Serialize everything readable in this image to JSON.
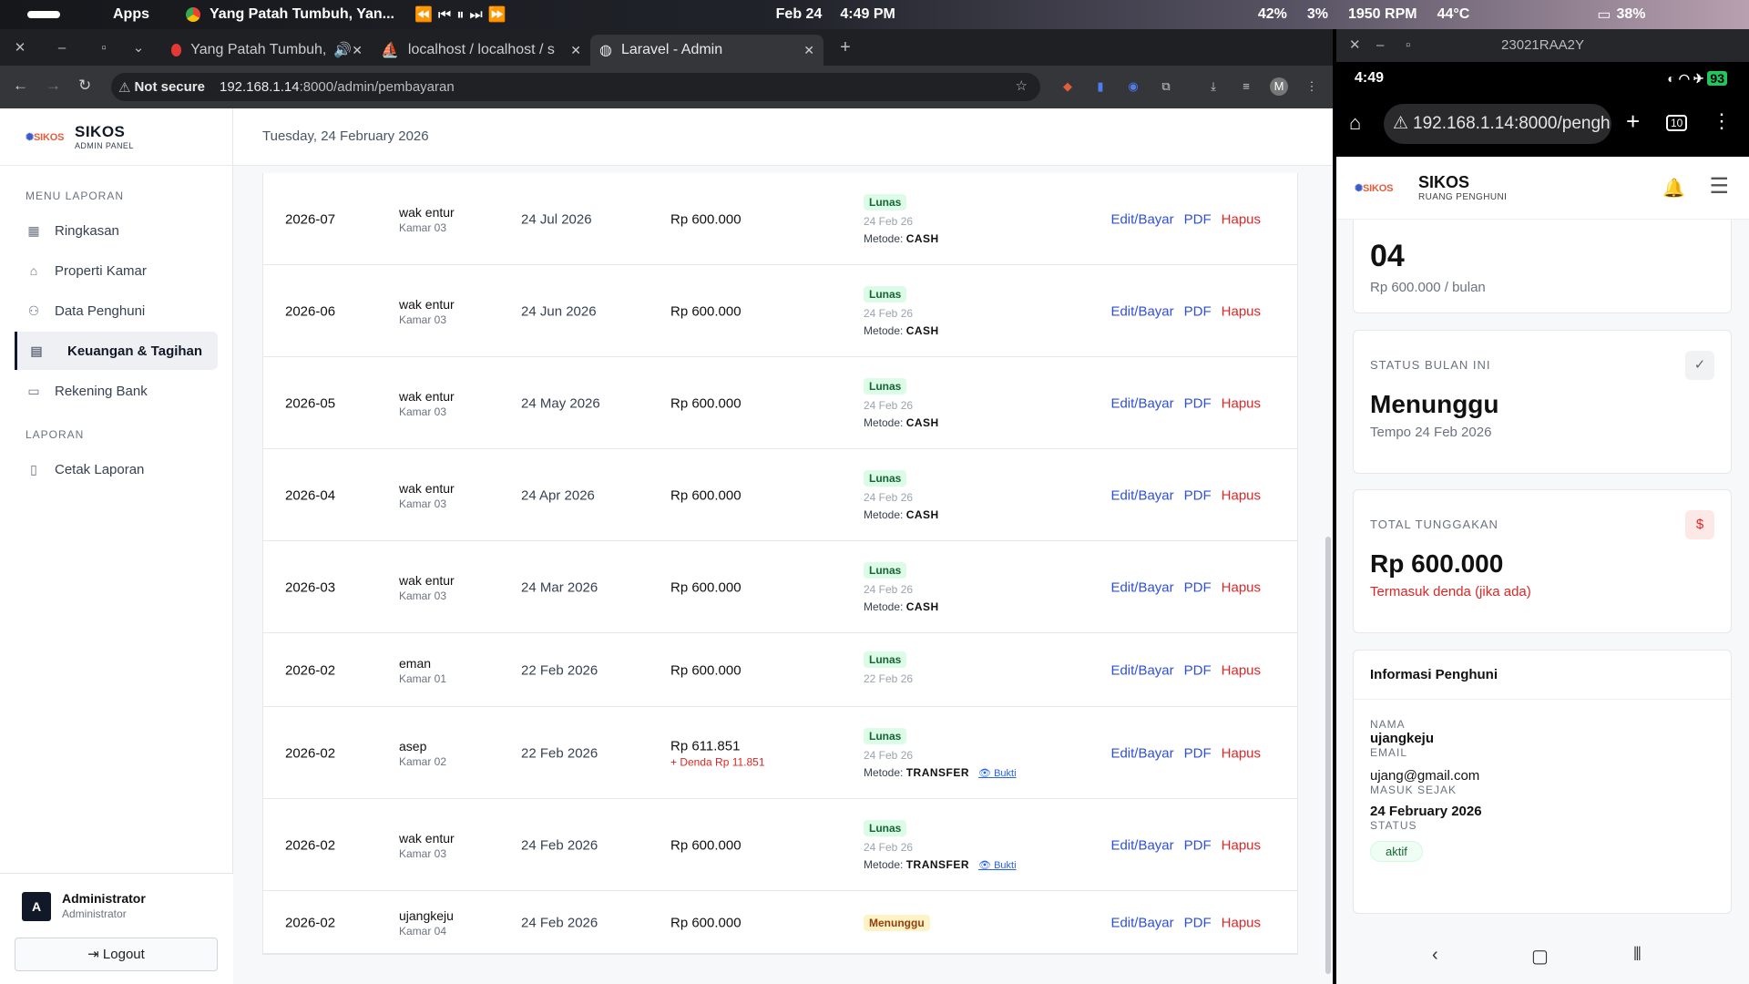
{
  "system_bar": {
    "apps": "Apps",
    "media_title": "Yang Patah Tumbuh, Yan...",
    "date": "Feb 24",
    "time": "4:49 PM",
    "cpu": "42%",
    "mem": "3%",
    "fan": "1950 RPM",
    "temp": "44°C",
    "battery": "38%"
  },
  "browser": {
    "tabs": [
      {
        "label": "Yang Patah Tumbuh,"
      },
      {
        "label": "localhost / localhost / s"
      },
      {
        "label": "Laravel - Admin"
      }
    ],
    "security": "Not secure",
    "url_host": "192.168.1.14",
    "url_path": ":8000/admin/pembayaran",
    "profile": "M"
  },
  "sidebar": {
    "brand": "SIKOS",
    "subtitle": "ADMIN PANEL",
    "logo_text": "SIKOS",
    "section_menu": "MENU LAPORAN",
    "items": [
      {
        "label": "Ringkasan",
        "icon": "grid-icon"
      },
      {
        "label": "Properti Kamar",
        "icon": "home-icon"
      },
      {
        "label": "Data Penghuni",
        "icon": "users-icon"
      },
      {
        "label": "Keuangan & Tagihan",
        "icon": "clipboard-icon"
      },
      {
        "label": "Rekening Bank",
        "icon": "card-icon"
      }
    ],
    "section_report": "LAPORAN",
    "report_items": [
      {
        "label": "Cetak Laporan",
        "icon": "document-icon"
      }
    ],
    "user": {
      "initial": "A",
      "name": "Administrator",
      "role": "Administrator"
    },
    "logout": "Logout"
  },
  "header": {
    "date": "Tuesday, 24 February 2026"
  },
  "payments": [
    {
      "period": "2026-07",
      "name": "wak entur",
      "room": "Kamar 03",
      "due": "24 Jul 2026",
      "amount": "Rp 600.000",
      "status": "Lunas",
      "paid": "24 Feb 26",
      "method_label": "Metode:",
      "method": "CASH"
    },
    {
      "period": "2026-06",
      "name": "wak entur",
      "room": "Kamar 03",
      "due": "24 Jun 2026",
      "amount": "Rp 600.000",
      "status": "Lunas",
      "paid": "24 Feb 26",
      "method_label": "Metode:",
      "method": "CASH"
    },
    {
      "period": "2026-05",
      "name": "wak entur",
      "room": "Kamar 03",
      "due": "24 May 2026",
      "amount": "Rp 600.000",
      "status": "Lunas",
      "paid": "24 Feb 26",
      "method_label": "Metode:",
      "method": "CASH"
    },
    {
      "period": "2026-04",
      "name": "wak entur",
      "room": "Kamar 03",
      "due": "24 Apr 2026",
      "amount": "Rp 600.000",
      "status": "Lunas",
      "paid": "24 Feb 26",
      "method_label": "Metode:",
      "method": "CASH"
    },
    {
      "period": "2026-03",
      "name": "wak entur",
      "room": "Kamar 03",
      "due": "24 Mar 2026",
      "amount": "Rp 600.000",
      "status": "Lunas",
      "paid": "24 Feb 26",
      "method_label": "Metode:",
      "method": "CASH"
    },
    {
      "period": "2026-02",
      "name": "eman",
      "room": "Kamar 01",
      "due": "22 Feb 2026",
      "amount": "Rp 600.000",
      "status": "Lunas",
      "paid": "22 Feb 26"
    },
    {
      "period": "2026-02",
      "name": "asep",
      "room": "Kamar 02",
      "due": "22 Feb 2026",
      "amount": "Rp 611.851",
      "fine": "+ Denda Rp 11.851",
      "status": "Lunas",
      "paid": "24 Feb 26",
      "method_label": "Metode:",
      "method": "TRANSFER",
      "proof": "Bukti"
    },
    {
      "period": "2026-02",
      "name": "wak entur",
      "room": "Kamar 03",
      "due": "24 Feb 2026",
      "amount": "Rp 600.000",
      "status": "Lunas",
      "paid": "24 Feb 26",
      "method_label": "Metode:",
      "method": "TRANSFER",
      "proof": "Bukti"
    },
    {
      "period": "2026-02",
      "name": "ujangkeju",
      "room": "Kamar 04",
      "due": "24 Feb 2026",
      "amount": "Rp 600.000",
      "status": "Menunggu"
    }
  ],
  "actions": {
    "edit": "Edit/Bayar",
    "pdf": "PDF",
    "delete": "Hapus"
  },
  "phone": {
    "window_title": "23021RAA2Y",
    "time": "4:49",
    "battery": "93",
    "url": "192.168.1.14:8000/pengh",
    "tabs_count": "10",
    "brand": "SIKOS",
    "subtitle": "RUANG PENGHUNI",
    "room_number": "04",
    "price": "Rp 600.000 / bulan",
    "status_label": "STATUS BULAN INI",
    "status_value": "Menunggu",
    "status_due": "Tempo 24 Feb 2026",
    "debt_label": "TOTAL TUNGGAKAN",
    "debt_value": "Rp 600.000",
    "debt_note": "Termasuk denda (jika ada)",
    "info_title": "Informasi Penghuni",
    "name_label": "NAMA",
    "name": "ujangkeju",
    "email_label": "EMAIL",
    "email": "ujang@gmail.com",
    "since_label": "MASUK SEJAK",
    "since": "24 February 2026",
    "status2_label": "STATUS",
    "status2": "aktif"
  },
  "colors": {
    "link": "#2f4fd6",
    "danger": "#dc2626",
    "paid_bg": "#dcfce7",
    "wait_bg": "#fef3c7"
  }
}
